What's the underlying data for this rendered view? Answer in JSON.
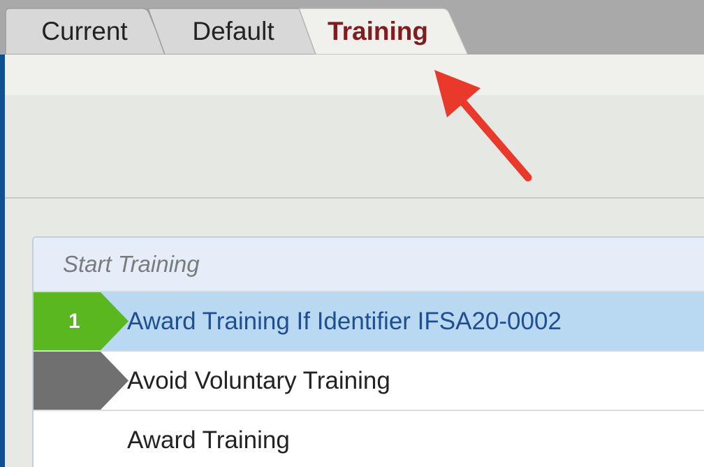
{
  "tabs": [
    {
      "label": "Current",
      "active": false
    },
    {
      "label": "Default",
      "active": false
    },
    {
      "label": "Training",
      "active": true
    }
  ],
  "colors": {
    "active_tab_text": "#7f1d20",
    "tabbar_bg": "#a9a9a9",
    "selected_row_bg": "#b9d9f2",
    "selected_row_text": "#1f4f91",
    "marker_active": "#5bb71f",
    "marker_inactive": "#707070",
    "arrow": "#e8392b",
    "left_edge": "#0f4f92"
  },
  "annotation": {
    "icon": "red-arrow-icon",
    "points_to": "Training"
  },
  "training_list": {
    "header": "Start Training",
    "rows": [
      {
        "number": "1",
        "label": "Award Training If Identifier IFSA20-0002",
        "marker": "green",
        "selected": true
      },
      {
        "number": "",
        "label": "Avoid Voluntary Training",
        "marker": "gray",
        "selected": false
      },
      {
        "number": "",
        "label": "Award Training",
        "marker": "none",
        "selected": false
      }
    ]
  }
}
